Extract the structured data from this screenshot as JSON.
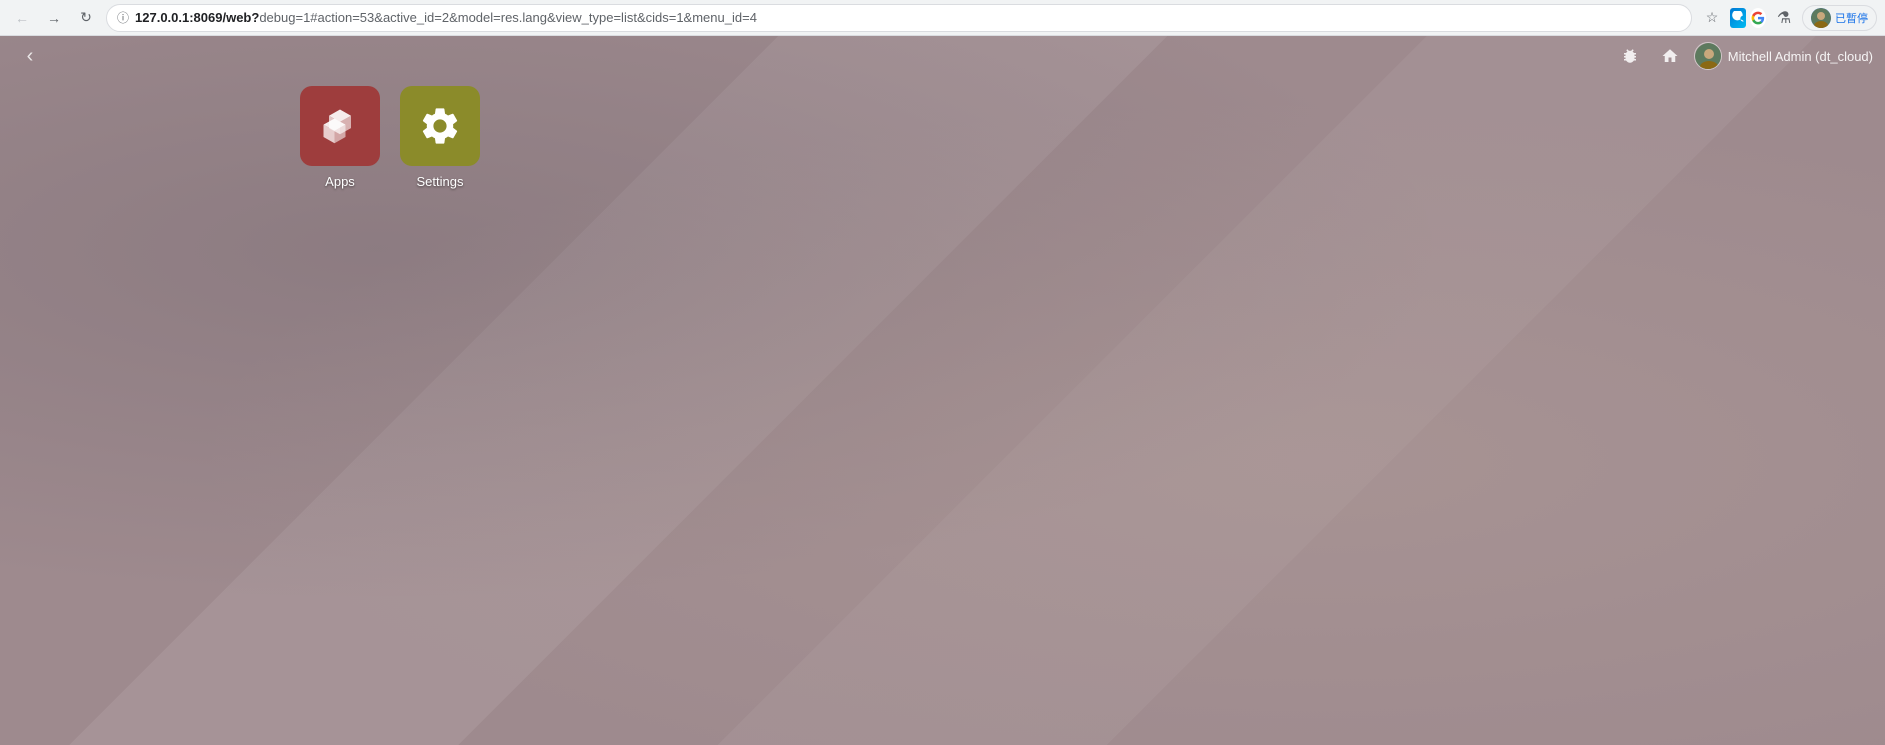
{
  "browser": {
    "url_bold": "127.0.0.1:8069/web?",
    "url_params": "debug=1#action=53&active_id=2&model=res.lang&view_type=list&cids=1&menu_id=4",
    "back_disabled": true,
    "forward_disabled": false,
    "reload_title": "Reload",
    "star_title": "Bookmark",
    "profile_name": "Mitchell Admin (dt_cloud)",
    "pause_label": "已暫停"
  },
  "topbar": {
    "bug_icon": "🐛",
    "home_icon": "🏠",
    "user_name": "Mitchell Admin (dt_cloud)"
  },
  "apps": [
    {
      "id": "apps",
      "label": "Apps",
      "color_class": "apps-color",
      "icon_type": "cubes"
    },
    {
      "id": "settings",
      "label": "Settings",
      "color_class": "settings-color",
      "icon_type": "gear"
    }
  ]
}
